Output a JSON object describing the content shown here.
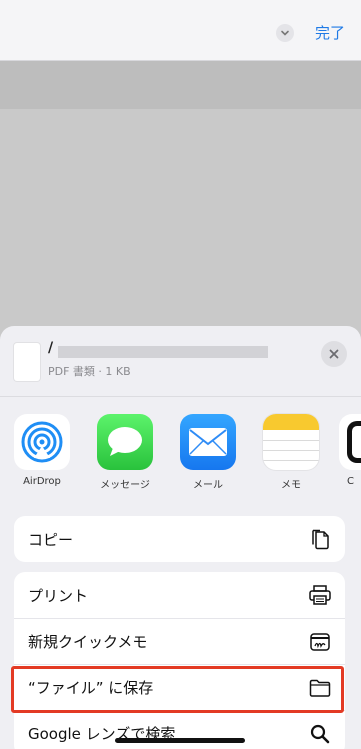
{
  "topbar": {
    "done_label": "完了"
  },
  "share_sheet": {
    "file": {
      "name": "/",
      "meta": "PDF 書類 · 1 KB"
    },
    "apps": [
      {
        "label": "AirDrop",
        "icon": "airdrop-icon"
      },
      {
        "label": "メッセージ",
        "icon": "messages-icon"
      },
      {
        "label": "メール",
        "icon": "mail-icon"
      },
      {
        "label": "メモ",
        "icon": "notes-icon"
      }
    ],
    "actions": [
      {
        "label": "コピー",
        "icon": "copy-icon"
      },
      {
        "label": "プリント",
        "icon": "printer-icon"
      },
      {
        "label": "新規クイックメモ",
        "icon": "quick-note-icon"
      },
      {
        "label": "“ファイル” に保存",
        "icon": "folder-icon"
      },
      {
        "label": "Google レンズで検索",
        "icon": "search-icon"
      }
    ]
  },
  "colors": {
    "accent": "#1f7ae6",
    "highlight": "#e33a24"
  }
}
